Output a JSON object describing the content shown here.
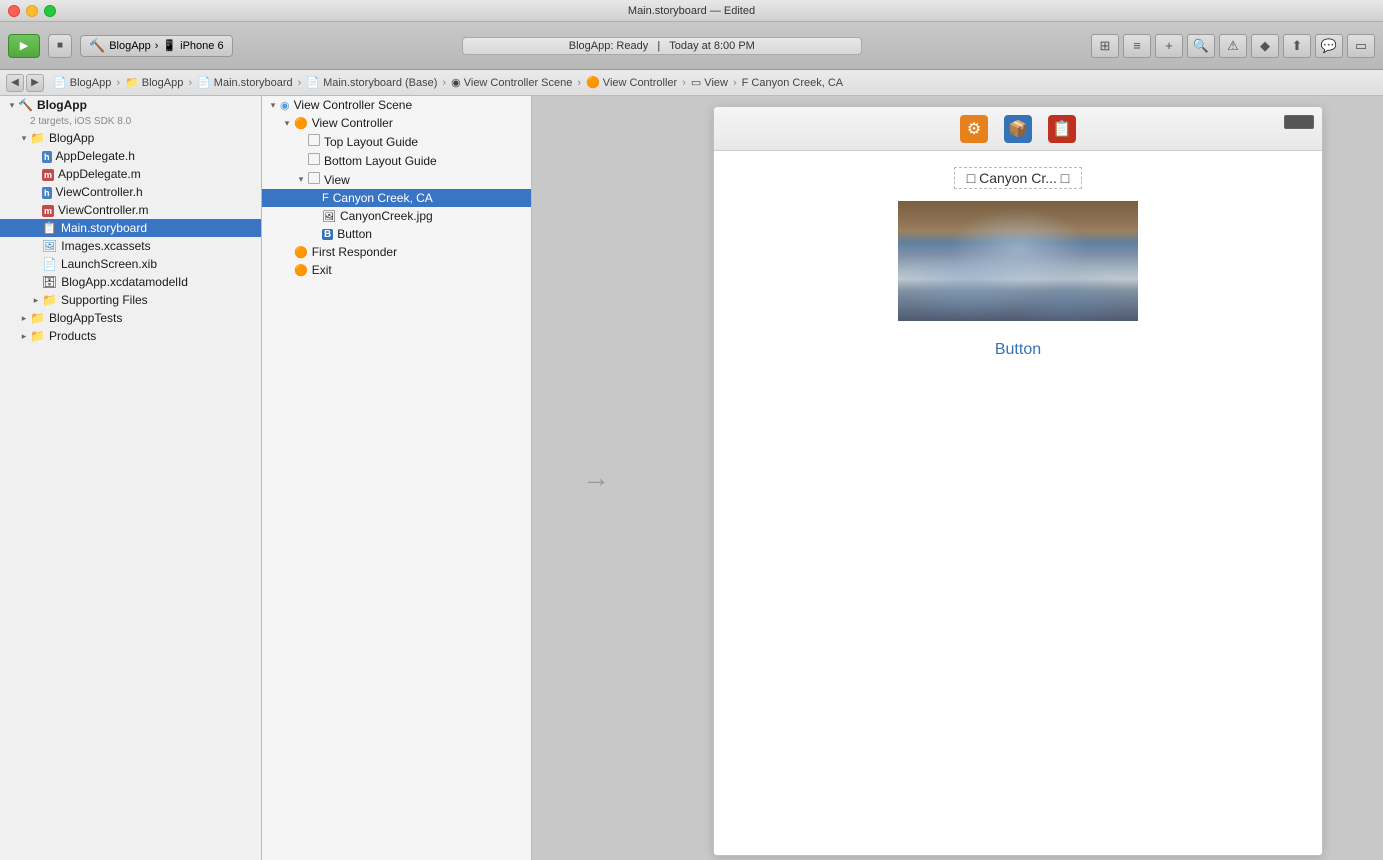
{
  "title_bar": {
    "title": "Main.storyboard — Edited",
    "dots": [
      "red",
      "yellow",
      "green"
    ]
  },
  "toolbar": {
    "scheme_name": "BlogApp",
    "device": "iPhone 6",
    "status_text": "BlogApp: Ready",
    "status_time": "Today at 8:00 PM"
  },
  "breadcrumb": {
    "items": [
      "BlogApp",
      "BlogApp",
      "Main.storyboard",
      "Main.storyboard (Base)",
      "View Controller Scene",
      "View Controller",
      "View",
      "Canyon Creek, CA"
    ]
  },
  "sidebar": {
    "project": {
      "name": "BlogApp",
      "subtitle": "2 targets, iOS SDK 8.0"
    },
    "items": [
      {
        "id": "blogapp-group",
        "label": "BlogApp",
        "indent": 1,
        "type": "folder-blue",
        "disclosure": "open"
      },
      {
        "id": "appdelegate-h",
        "label": "AppDelegate.h",
        "indent": 2,
        "type": "h",
        "disclosure": "none"
      },
      {
        "id": "appdelegate-m",
        "label": "AppDelegate.m",
        "indent": 2,
        "type": "m",
        "disclosure": "none"
      },
      {
        "id": "viewcontroller-h",
        "label": "ViewController.h",
        "indent": 2,
        "type": "h",
        "disclosure": "none"
      },
      {
        "id": "viewcontroller-m",
        "label": "ViewController.m",
        "indent": 2,
        "type": "m",
        "disclosure": "none"
      },
      {
        "id": "main-storyboard",
        "label": "Main.storyboard",
        "indent": 2,
        "type": "storyboard",
        "disclosure": "none",
        "selected": true
      },
      {
        "id": "images-xcassets",
        "label": "Images.xcassets",
        "indent": 2,
        "type": "xcassets",
        "disclosure": "none"
      },
      {
        "id": "launchscreen-xib",
        "label": "LaunchScreen.xib",
        "indent": 2,
        "type": "xib",
        "disclosure": "none"
      },
      {
        "id": "blogapp-xcdatamodel",
        "label": "BlogApp.xcdatamodelId",
        "indent": 2,
        "type": "xcdatamodel",
        "disclosure": "none"
      },
      {
        "id": "supporting-files",
        "label": "Supporting Files",
        "indent": 2,
        "type": "folder",
        "disclosure": "closed"
      },
      {
        "id": "blogapptests",
        "label": "BlogAppTests",
        "indent": 1,
        "type": "folder-blue",
        "disclosure": "closed"
      },
      {
        "id": "products",
        "label": "Products",
        "indent": 1,
        "type": "folder",
        "disclosure": "closed"
      }
    ]
  },
  "outline": {
    "items": [
      {
        "id": "vc-scene",
        "label": "View Controller Scene",
        "indent": 0,
        "type": "scene",
        "disclosure": "open"
      },
      {
        "id": "vc",
        "label": "View Controller",
        "indent": 1,
        "type": "vc",
        "disclosure": "open"
      },
      {
        "id": "top-layout",
        "label": "Top Layout Guide",
        "indent": 2,
        "type": "layout",
        "disclosure": "none"
      },
      {
        "id": "bottom-layout",
        "label": "Bottom Layout Guide",
        "indent": 2,
        "type": "layout",
        "disclosure": "none"
      },
      {
        "id": "view",
        "label": "View",
        "indent": 2,
        "type": "view",
        "disclosure": "open"
      },
      {
        "id": "canyon-creek-label",
        "label": "Canyon Creek, CA",
        "indent": 3,
        "type": "label",
        "disclosure": "none",
        "selected": true
      },
      {
        "id": "canyon-creek-image",
        "label": "CanyonCreek.jpg",
        "indent": 3,
        "type": "image",
        "disclosure": "none"
      },
      {
        "id": "button",
        "label": "Button",
        "indent": 3,
        "type": "button",
        "disclosure": "none"
      },
      {
        "id": "first-responder",
        "label": "First Responder",
        "indent": 1,
        "type": "responder",
        "disclosure": "none"
      },
      {
        "id": "exit",
        "label": "Exit",
        "indent": 1,
        "type": "exit",
        "disclosure": "none"
      }
    ]
  },
  "canvas": {
    "arrow": "→",
    "iphone": {
      "label_text": "□ Canyon Cr... □",
      "image_label": "CanyonCreek.jpg",
      "button_label": "Button"
    }
  },
  "icons": {
    "run": "▶",
    "stop": "■",
    "folder": "📁",
    "file": "📄"
  }
}
